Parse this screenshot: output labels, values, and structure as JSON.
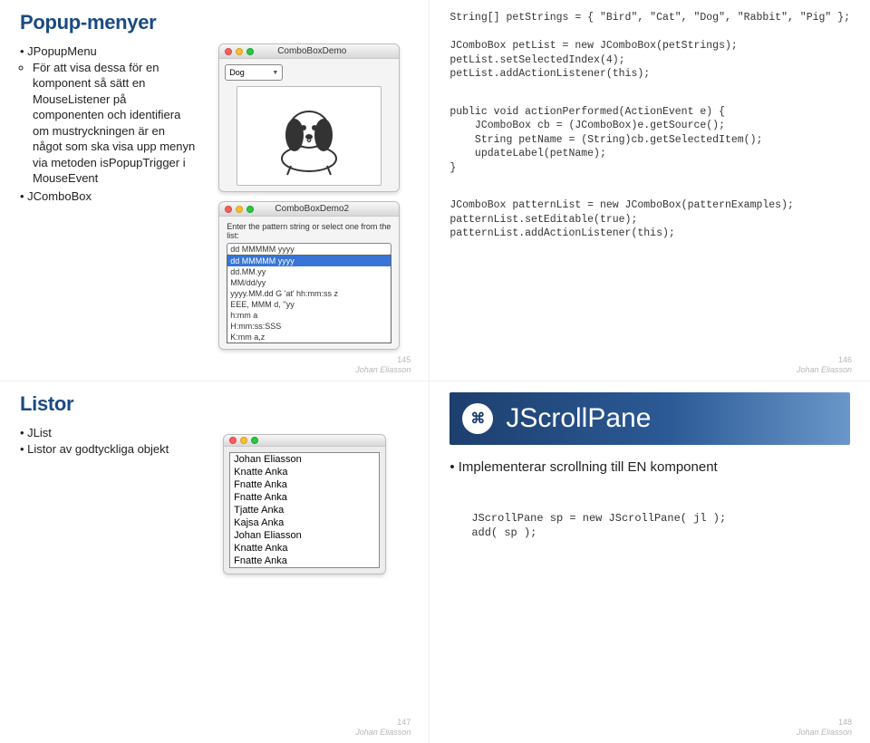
{
  "slide145": {
    "title": "Popup-menyer",
    "bullets": {
      "b1": "JPopupMenu",
      "sub1": "För att visa dessa för en komponent så sätt en MouseListener på componenten och identifiera om mustryckningen är en något som ska visa upp menyn via metoden isPopupTrigger i MouseEvent",
      "b2": "JComboBox"
    },
    "win1": {
      "title": "ComboBoxDemo",
      "selected": "Dog"
    },
    "win2": {
      "title": "ComboBoxDemo2",
      "prompt": "Enter the pattern string or select one from the list:",
      "input": "dd MMMMM yyyy",
      "opts": {
        "o0": "dd MMMMM yyyy",
        "o1": "dd.MM.yy",
        "o2": "MM/dd/yy",
        "o3": "yyyy.MM.dd G 'at' hh:mm:ss z",
        "o4": "EEE, MMM d, ''yy",
        "o5": "h:mm a",
        "o6": "H:mm:ss:SSS",
        "o7": "K:mm a,z"
      }
    },
    "page": "145",
    "author": "Johan Eliasson"
  },
  "slide146": {
    "code1": "String[] petStrings = { \"Bird\", \"Cat\", \"Dog\", \"Rabbit\", \"Pig\" };\n\nJComboBox petList = new JComboBox(petStrings);\npetList.setSelectedIndex(4);\npetList.addActionListener(this);",
    "code2": "public void actionPerformed(ActionEvent e) {\n    JComboBox cb = (JComboBox)e.getSource();\n    String petName = (String)cb.getSelectedItem();\n    updateLabel(petName);\n}",
    "code3": "JComboBox patternList = new JComboBox(patternExamples);\npatternList.setEditable(true);\npatternList.addActionListener(this);",
    "page": "146",
    "author": "Johan Eliasson"
  },
  "slide147": {
    "title": "Listor",
    "bullets": {
      "b1": "JList",
      "b2": "Listor av godtyckliga objekt"
    },
    "list": {
      "i0": "Johan Eliasson",
      "i1": "Knatte Anka",
      "i2": "Fnatte Anka",
      "i3": "Fnatte Anka",
      "i4": "Tjatte Anka",
      "i5": "Kajsa Anka",
      "i6": "Johan Eliasson",
      "i7": "Knatte Anka",
      "i8": "Fnatte Anka"
    },
    "page": "147",
    "author": "Johan Eliasson"
  },
  "slide148": {
    "title": "JScrollPane",
    "logo": "⌘",
    "desc": "Implementerar scrollning till EN komponent",
    "code": "JScrollPane sp = new JScrollPane( jl );\nadd( sp );",
    "page": "148",
    "author": "Johan Eliasson"
  }
}
